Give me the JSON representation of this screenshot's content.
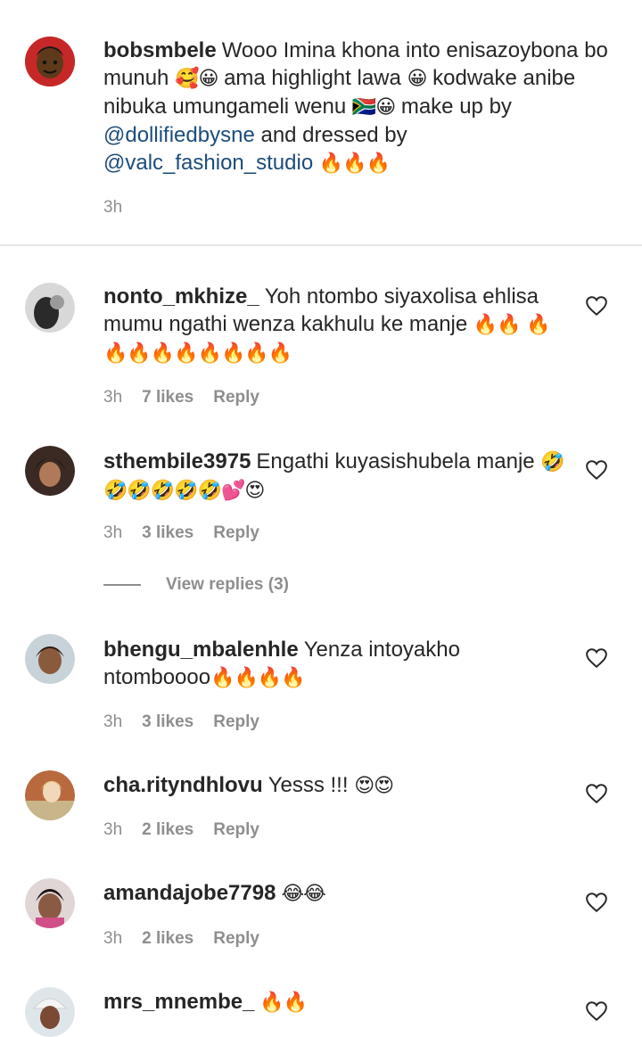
{
  "caption": {
    "username": "bobsmbele",
    "text_a": "Wooo Imina khona into enisazoybona bo munuh",
    "emoji_a": "🥰😀",
    "text_b": "ama highlight lawa",
    "emoji_b": "😀",
    "text_c": "kodwake anibe nibuka umungameli wenu",
    "emoji_c": "🇿🇦😀",
    "text_d": "make up by",
    "mention_1": "@dollifiedbysne",
    "text_e": "and dressed by",
    "mention_2": "@valc_fashion_studio",
    "emoji_e": "🔥🔥🔥",
    "time": "3h"
  },
  "comments": [
    {
      "username": "nonto_mkhize_",
      "text": "Yoh ntombo siyaxolisa ehlisa mumu ngathi wenza kakhulu ke manje",
      "emoji": "🔥🔥",
      "emoji2": "🔥🔥🔥🔥🔥🔥🔥🔥🔥",
      "time": "3h",
      "likes": "7 likes",
      "reply": "Reply"
    },
    {
      "username": "sthembile3975",
      "text": "Engathi kuyasishubela manje",
      "emoji": "🤣🤣🤣🤣🤣🤣💕😍",
      "time": "3h",
      "likes": "3 likes",
      "reply": "Reply"
    },
    {
      "username": "bhengu_mbalenhle",
      "text": "Yenza intoyakho ntomboooo",
      "emoji": "🔥🔥🔥🔥",
      "time": "3h",
      "likes": "3 likes",
      "reply": "Reply"
    },
    {
      "username": "cha.rityndhlovu",
      "text": "Yesss !!!",
      "emoji": "😍😍",
      "time": "3h",
      "likes": "2 likes",
      "reply": "Reply"
    },
    {
      "username": "amandajobe7798",
      "text": "",
      "emoji": "😂😂",
      "time": "3h",
      "likes": "2 likes",
      "reply": "Reply"
    },
    {
      "username": "mrs_mnembe_",
      "text": "",
      "emoji": "🔥🔥",
      "time": "",
      "likes": "",
      "reply": ""
    }
  ],
  "view_replies": "View replies (3)",
  "colors": {
    "text": "#262626",
    "muted": "#8e8e8e",
    "mention": "#1c4d7a",
    "divider": "#e6e6e6"
  }
}
